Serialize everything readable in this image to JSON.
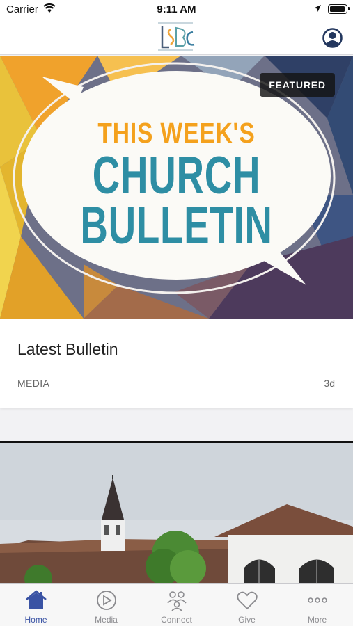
{
  "status_bar": {
    "carrier": "Carrier",
    "time": "9:11 AM"
  },
  "header": {
    "logo_icon": "church-logo",
    "profile_icon": "profile-icon"
  },
  "featured_card": {
    "badge": "FEATURED",
    "image_text": {
      "line1": "THIS WEEK'S",
      "line2": "CHURCH",
      "line3": "BULLETIN"
    },
    "title": "Latest Bulletin",
    "category": "MEDIA",
    "age": "3d"
  },
  "tabs": [
    {
      "label": "Home",
      "icon": "home-icon",
      "active": true
    },
    {
      "label": "Media",
      "icon": "play-icon",
      "active": false
    },
    {
      "label": "Connect",
      "icon": "people-icon",
      "active": false
    },
    {
      "label": "Give",
      "icon": "heart-icon",
      "active": false
    },
    {
      "label": "More",
      "icon": "more-icon",
      "active": false
    }
  ],
  "colors": {
    "accent": "#3a53a4",
    "inactive": "#8a8a8e",
    "bulletin_orange": "#f4a11d",
    "bulletin_teal": "#2e8ea4"
  }
}
